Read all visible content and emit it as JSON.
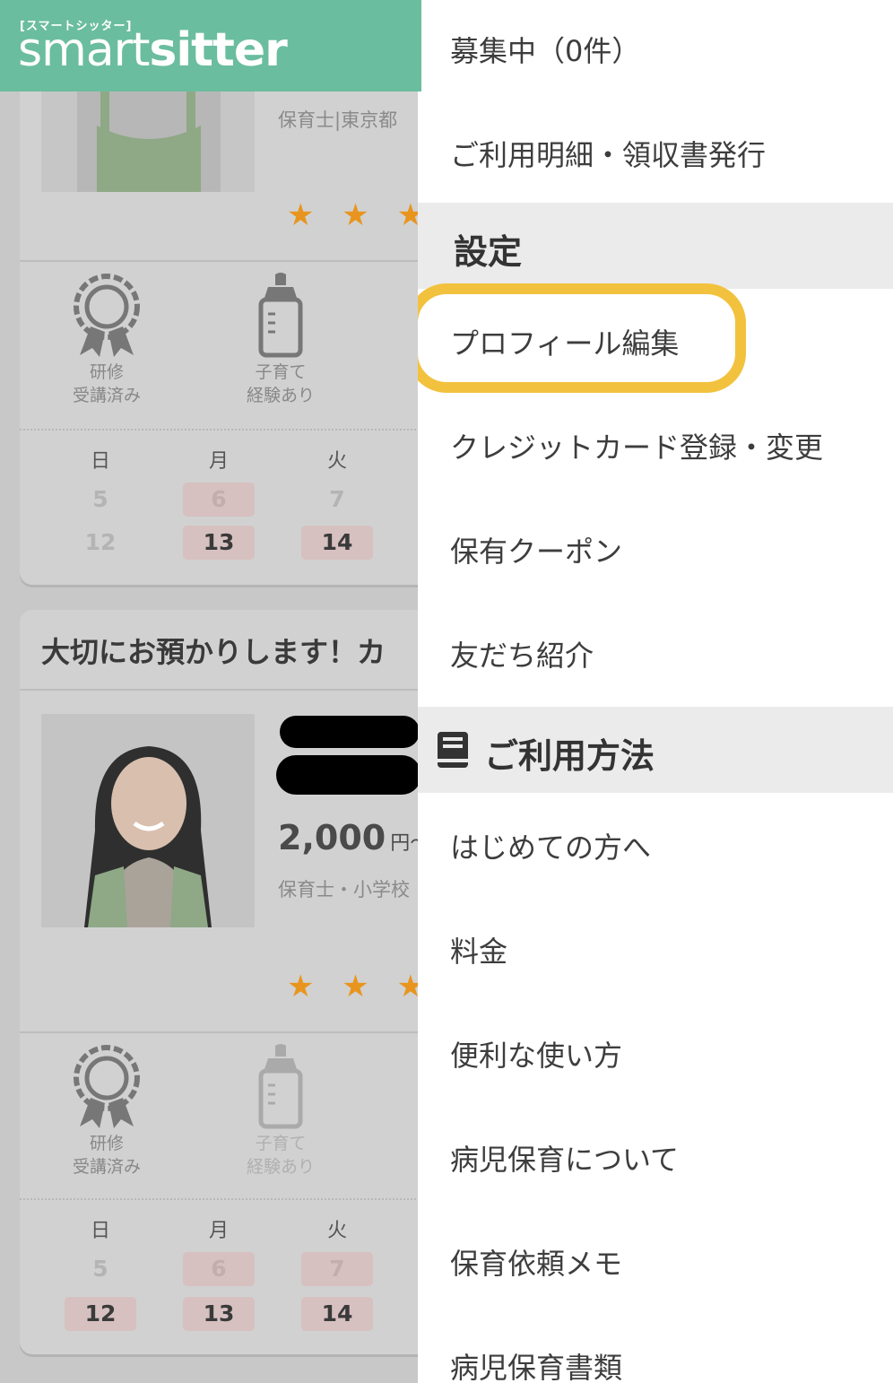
{
  "header": {
    "logo_kana": "[スマートシッター]",
    "logo_word_a": "smart",
    "logo_word_b": "sitter"
  },
  "cards": [
    {
      "meta": "保育士|東京都",
      "stars": "★ ★ ★ ★",
      "features": [
        {
          "icon": "ribbon-award-icon",
          "line1": "研修",
          "line2": "受講済み",
          "active": true
        },
        {
          "icon": "baby-bottle-icon",
          "line1": "子育て",
          "line2": "経験あり",
          "active": true
        }
      ],
      "calendar": {
        "days": [
          "日",
          "月",
          "火"
        ],
        "row1": [
          {
            "v": "5"
          },
          {
            "v": "6"
          },
          {
            "v": "7"
          }
        ],
        "row2": [
          {
            "v": "12"
          },
          {
            "v": "13"
          },
          {
            "v": "14"
          }
        ]
      }
    },
    {
      "title": "大切にお預かりします！カ",
      "price": "2,000",
      "unit": "円〜",
      "meta": "保育士・小学校",
      "stars": "★ ★ ★ ★",
      "features": [
        {
          "icon": "ribbon-award-icon",
          "line1": "研修",
          "line2": "受講済み",
          "active": true
        },
        {
          "icon": "baby-bottle-icon",
          "line1": "子育て",
          "line2": "経験あり",
          "active": false
        }
      ],
      "calendar": {
        "days": [
          "日",
          "月",
          "火"
        ],
        "row1": [
          {
            "v": "5"
          },
          {
            "v": "6"
          },
          {
            "v": "7"
          }
        ],
        "row2": [
          {
            "v": "12"
          },
          {
            "v": "13"
          },
          {
            "v": "14"
          }
        ]
      }
    }
  ],
  "menu": {
    "top_items": [
      "募集中（0件）",
      "ご利用明細・領収書発行"
    ],
    "settings": {
      "title": "設定",
      "items": [
        "プロフィール編集",
        "クレジットカード登録・変更",
        "保有クーポン",
        "友だち紹介"
      ]
    },
    "usage": {
      "title": "ご利用方法",
      "icon": "book-icon",
      "items": [
        "はじめての方へ",
        "料金",
        "便利な使い方",
        "病児保育について",
        "保育依頼メモ",
        "病児保育書類"
      ]
    },
    "highlight_color": "#f2c23e"
  },
  "colors": {
    "brand": "#6bbd9f",
    "star": "#e8951f",
    "highlight": "#f2c23e"
  }
}
